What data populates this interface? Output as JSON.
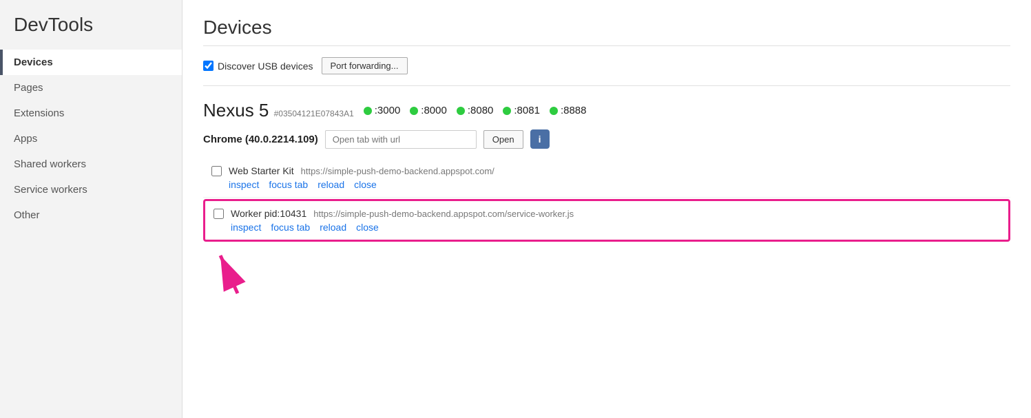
{
  "app": {
    "title": "DevTools"
  },
  "sidebar": {
    "items": [
      {
        "id": "devices",
        "label": "Devices",
        "active": true
      },
      {
        "id": "pages",
        "label": "Pages",
        "active": false
      },
      {
        "id": "extensions",
        "label": "Extensions",
        "active": false
      },
      {
        "id": "apps",
        "label": "Apps",
        "active": false
      },
      {
        "id": "shared-workers",
        "label": "Shared workers",
        "active": false
      },
      {
        "id": "service-workers",
        "label": "Service workers",
        "active": false
      },
      {
        "id": "other",
        "label": "Other",
        "active": false
      }
    ]
  },
  "main": {
    "title": "Devices",
    "discover_usb_label": "Discover USB devices",
    "port_forwarding_label": "Port forwarding...",
    "device": {
      "name": "Nexus 5",
      "id": "#03504121E07843A1",
      "ports": [
        ":3000",
        ":8000",
        ":8080",
        ":8081",
        ":8888"
      ]
    },
    "chrome": {
      "label": "Chrome (40.0.2214.109)",
      "url_placeholder": "Open tab with url",
      "open_label": "Open",
      "info_label": "i"
    },
    "tabs": [
      {
        "id": "web-starter-kit",
        "title": "Web Starter Kit",
        "url": "https://simple-push-demo-backend.appspot.com/",
        "actions": [
          "inspect",
          "focus tab",
          "reload",
          "close"
        ],
        "highlighted": false
      },
      {
        "id": "worker",
        "title": "Worker pid:10431",
        "url": "https://simple-push-demo-backend.appspot.com/service-worker.js",
        "actions": [
          "inspect",
          "focus tab",
          "reload",
          "close"
        ],
        "highlighted": true
      }
    ]
  }
}
